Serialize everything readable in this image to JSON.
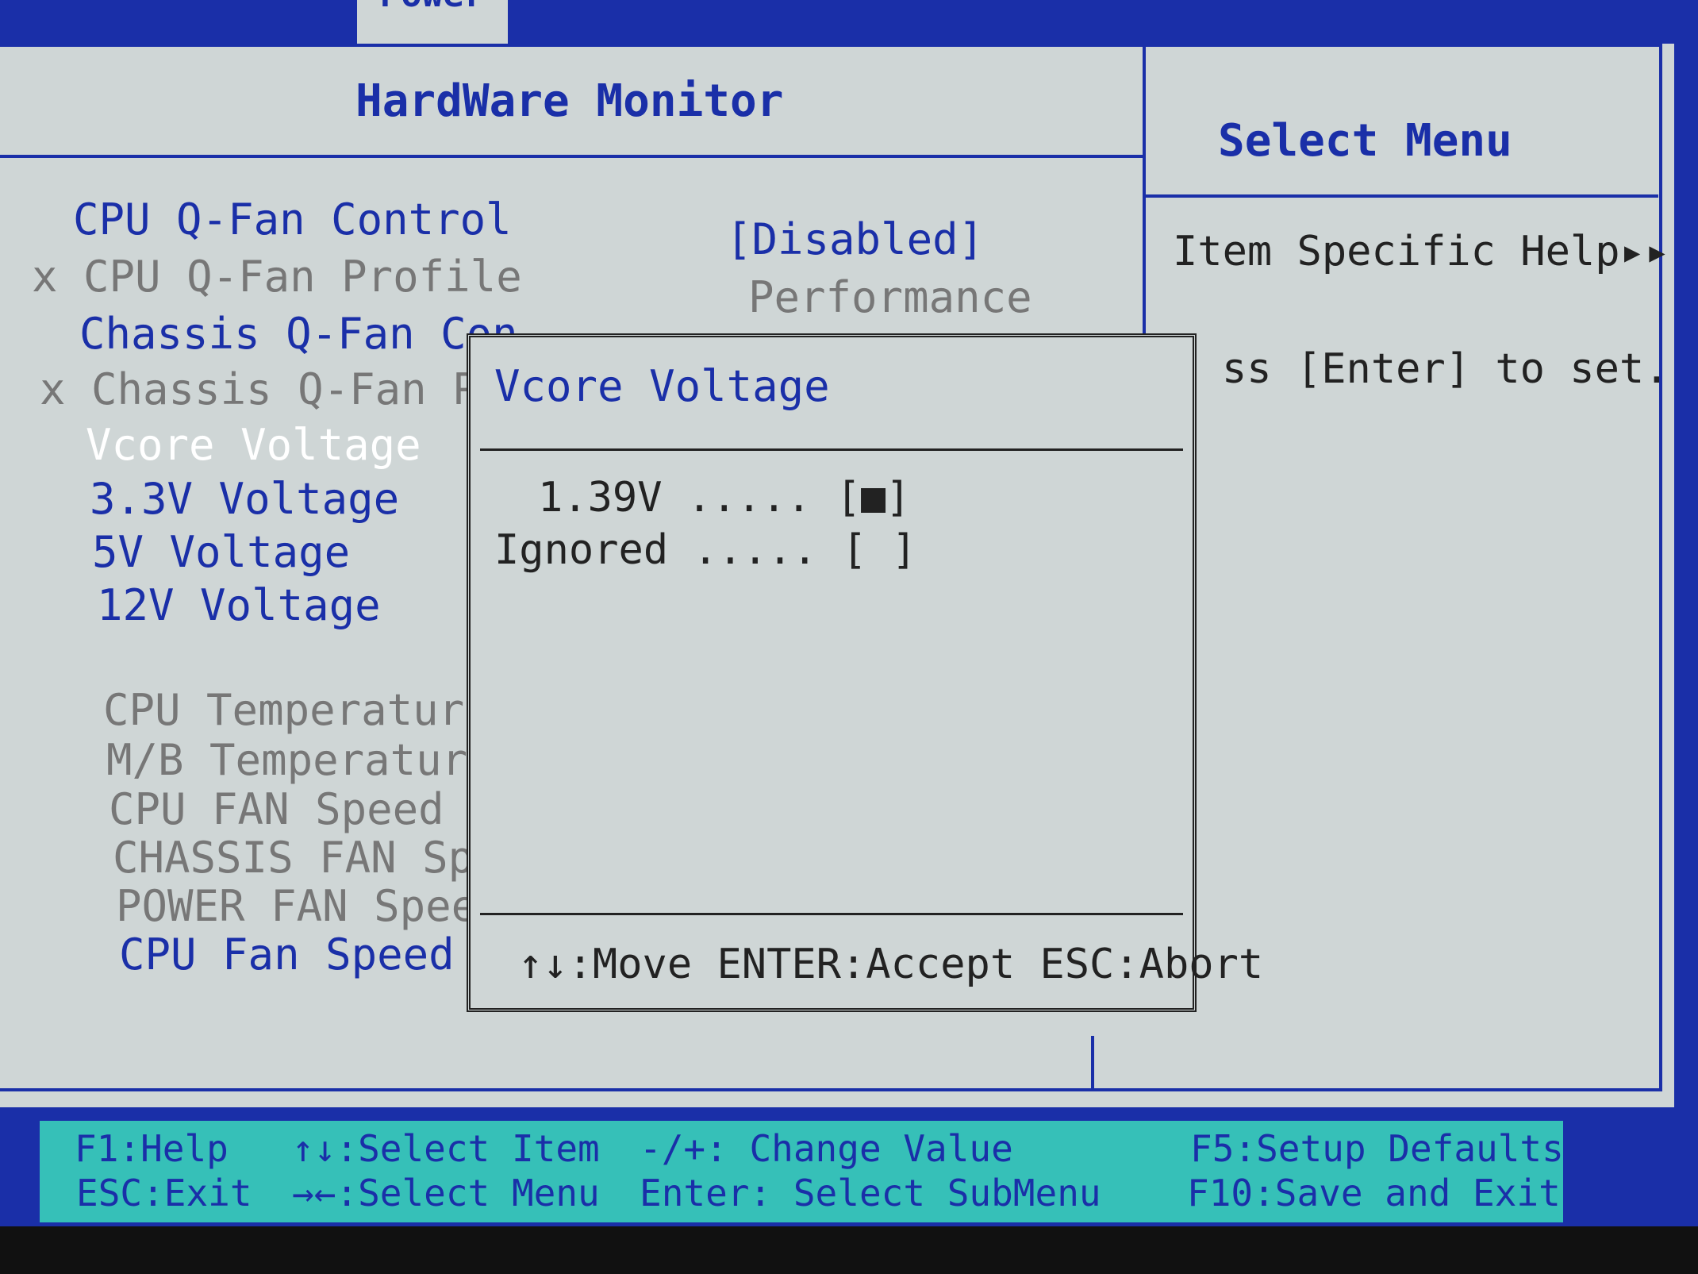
{
  "tabs": {
    "active": "Power"
  },
  "header": {
    "title": "HardWare Monitor",
    "side_title": "Select Menu"
  },
  "items": [
    {
      "label": "CPU Q-Fan Control",
      "value": "[Disabled]"
    },
    {
      "label": "x CPU Q-Fan Profile",
      "value": "Performance"
    },
    {
      "label": "Chassis Q-Fan Con"
    },
    {
      "label": "x Chassis Q-Fan Pro"
    },
    {
      "label": "Vcore Voltage"
    },
    {
      "label": "3.3V Voltage"
    },
    {
      "label": "5V Voltage"
    },
    {
      "label": "12V Voltage"
    },
    {
      "label": "CPU Temperature"
    },
    {
      "label": "M/B Temperature"
    },
    {
      "label": "CPU FAN Speed"
    },
    {
      "label": "CHASSIS FAN Speed"
    },
    {
      "label": "POWER FAN Speed"
    },
    {
      "label": "CPU Fan Speed War"
    }
  ],
  "help": {
    "title": "Item Specific Help▸▸",
    "text": "ss [Enter] to set."
  },
  "dialog": {
    "title": "Vcore Voltage",
    "options": [
      {
        "label": "1.39V ..... [■]"
      },
      {
        "label": "Ignored ..... [ ]"
      }
    ],
    "hint": "↑↓:Move ENTER:Accept ESC:Abort"
  },
  "footer": {
    "f1": "F1:Help",
    "esc": "ESC:Exit",
    "select_item": "↑↓:Select Item",
    "select_menu": "→←:Select Menu",
    "change_value": "-/+: Change Value",
    "select_submenu": "Enter: Select SubMenu",
    "f5": "F5:Setup Defaults",
    "f10": "F10:Save and Exit"
  },
  "colors": {
    "bios_blue": "#1a2fa8",
    "panel_gray": "#cfd6d6",
    "footer_teal": "#36c0b8",
    "selected_white": "#ffffff"
  }
}
